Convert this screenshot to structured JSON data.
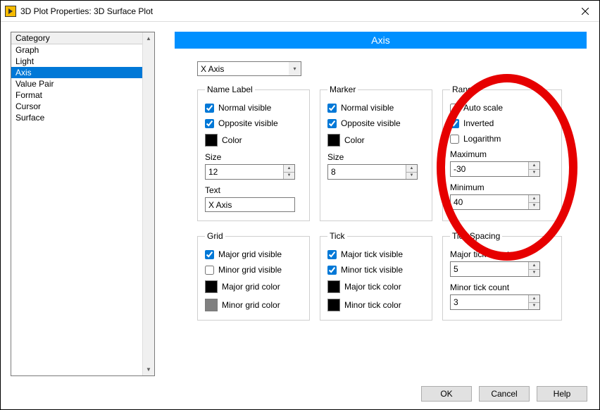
{
  "titlebar": {
    "title": "3D Plot Properties: 3D Surface Plot"
  },
  "sidebar": {
    "header": "Category",
    "items": [
      {
        "label": "Graph"
      },
      {
        "label": "Light"
      },
      {
        "label": "Axis",
        "selected": true
      },
      {
        "label": "Value Pair"
      },
      {
        "label": "Format"
      },
      {
        "label": "Cursor"
      },
      {
        "label": "Surface"
      }
    ]
  },
  "banner": "Axis",
  "axis_select": {
    "value": "X Axis"
  },
  "groups": {
    "name_label": {
      "legend": "Name Label",
      "normal_visible": {
        "label": "Normal visible",
        "checked": true
      },
      "opposite_visible": {
        "label": "Opposite visible",
        "checked": true
      },
      "color_label": "Color",
      "color": "#000000",
      "size_label": "Size",
      "size_value": "12",
      "text_label": "Text",
      "text_value": "X Axis"
    },
    "marker": {
      "legend": "Marker",
      "normal_visible": {
        "label": "Normal visible",
        "checked": true
      },
      "opposite_visible": {
        "label": "Opposite visible",
        "checked": true
      },
      "color_label": "Color",
      "color": "#000000",
      "size_label": "Size",
      "size_value": "8"
    },
    "range": {
      "legend": "Range",
      "auto_scale": {
        "label": "Auto scale",
        "checked": false
      },
      "inverted": {
        "label": "Inverted",
        "checked": true
      },
      "logarithm": {
        "label": "Logarithm",
        "checked": false
      },
      "maximum_label": "Maximum",
      "maximum_value": "-30",
      "minimum_label": "Minimum",
      "minimum_value": "40"
    },
    "grid": {
      "legend": "Grid",
      "major_visible": {
        "label": "Major grid visible",
        "checked": true
      },
      "minor_visible": {
        "label": "Minor grid visible",
        "checked": false
      },
      "major_color_label": "Major grid color",
      "major_color": "#000000",
      "minor_color_label": "Minor grid color",
      "minor_color": "#808080"
    },
    "tick": {
      "legend": "Tick",
      "major_visible": {
        "label": "Major tick visible",
        "checked": true
      },
      "minor_visible": {
        "label": "Minor tick visible",
        "checked": true
      },
      "major_color_label": "Major tick color",
      "major_color": "#000000",
      "minor_color_label": "Minor tick color",
      "minor_color": "#000000"
    },
    "tick_spacing": {
      "legend": "Tick Spacing",
      "major_count_label": "Major tick count",
      "major_count_value": "5",
      "minor_count_label": "Minor tick count",
      "minor_count_value": "3"
    }
  },
  "buttons": {
    "ok": "OK",
    "cancel": "Cancel",
    "help": "Help"
  }
}
